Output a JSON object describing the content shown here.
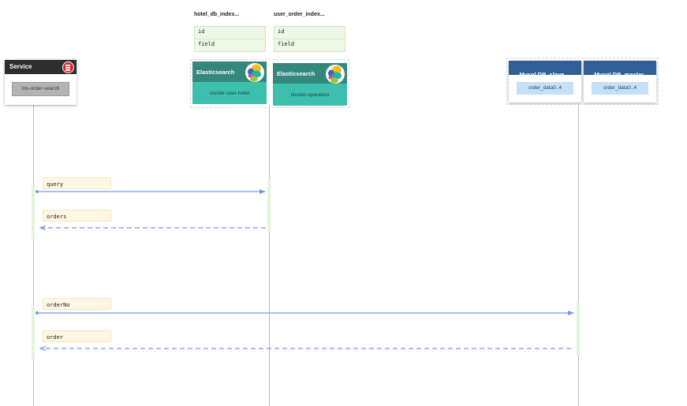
{
  "service": {
    "title": "Service",
    "component": "tns-order-search",
    "badge_icon": "list-icon"
  },
  "indexes": [
    {
      "title": "hotel_db_index...",
      "fields": [
        "id",
        "field"
      ]
    },
    {
      "title": "user_order_index...",
      "fields": [
        "id",
        "field"
      ]
    }
  ],
  "elasticsearch": [
    {
      "title": "Elasticsearch",
      "cluster": "cluster-user-hotel",
      "icon": "elasticsearch-icon"
    },
    {
      "title": "Elasticsearch",
      "cluster": "cluster-operation",
      "icon": "elasticsearch-icon"
    }
  ],
  "mysql": [
    {
      "title": "Mysql DB  slave",
      "table": "order_data0..4"
    },
    {
      "title": "Mysql DB  master",
      "table": "order_data0..4"
    }
  ],
  "messages": [
    {
      "label": "query",
      "style": "solid"
    },
    {
      "label": "orders",
      "style": "dashed"
    },
    {
      "label": "orderNo",
      "style": "solid"
    },
    {
      "label": "order",
      "style": "dashed"
    }
  ],
  "colors": {
    "arrow": "#6f9ae6",
    "service_header": "#2e2e2e",
    "es_header": "#33877d",
    "es_body": "#3dbfae",
    "db_header": "#2f5f95",
    "db_inner": "#c6e0f5",
    "note_fill": "#fff7e3",
    "activation": "#e4f3dc"
  }
}
